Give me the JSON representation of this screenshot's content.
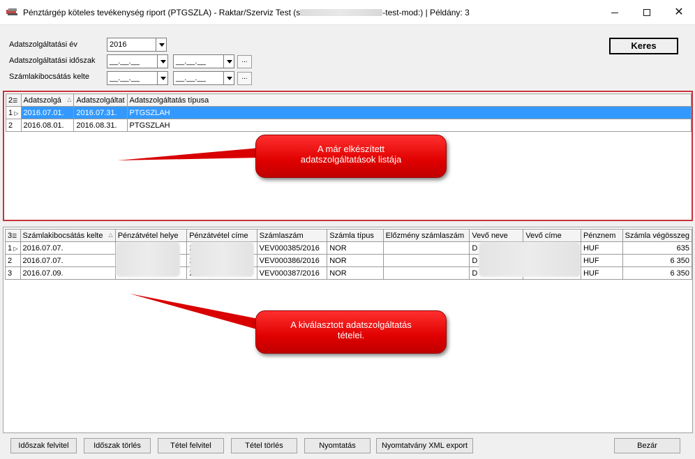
{
  "window": {
    "title_prefix": "Pénztárgép köteles tevékenység riport (PTGSZLA) - Raktar/Szerviz Test (s",
    "title_suffix": "-test-mod:) | Példány: 3",
    "minimize": "minimize",
    "maximize": "maximize",
    "close": "✕"
  },
  "filters": {
    "year_label": "Adatszolgáltatási év",
    "year_value": "2016",
    "period_label": "Adatszolgáltatási időszak",
    "period_from": "__.__.__",
    "period_to": "__.__.__",
    "invoice_date_label": "Számlakibocsátás kelte",
    "invoice_from": "__.__.__",
    "invoice_to": "__.__.__",
    "ellipsis": "...",
    "search_button": "Keres"
  },
  "grid1": {
    "corner": "2",
    "columns": [
      "Adatszolgá",
      "Adatszolgáltat",
      "Adatszolgáltatás típusa"
    ],
    "rows": [
      {
        "n": "1",
        "from": "2016.07.01.",
        "to": "2016.07.31.",
        "type": "PTGSZLAH"
      },
      {
        "n": "2",
        "from": "2016.08.01.",
        "to": "2016.08.31.",
        "type": "PTGSZLAH"
      }
    ]
  },
  "grid2": {
    "corner": "3",
    "columns": [
      "Számlakibocsátás kelte",
      "Pénzátvétel helye",
      "Pénzátvétel címe",
      "Számlaszám",
      "Számla típus",
      "Előzmény számlaszám",
      "Vevő neve",
      "Vevő címe",
      "Pénznem",
      "Számla végösszeg"
    ],
    "rows": [
      {
        "n": "1",
        "date": "2016.07.07.",
        "place": "",
        "addr": "2",
        "inv": "VEV000385/2016",
        "type": "NOR",
        "prev": "",
        "cust": "D",
        "caddr": "",
        "cur": "HUF",
        "total": "635"
      },
      {
        "n": "2",
        "date": "2016.07.07.",
        "place": "",
        "addr": "2",
        "inv": "VEV000386/2016",
        "type": "NOR",
        "prev": "",
        "cust": "D",
        "caddr": "",
        "cur": "HUF",
        "total": "6 350"
      },
      {
        "n": "3",
        "date": "2016.07.09.",
        "place": "",
        "addr": "2",
        "inv": "VEV000387/2016",
        "type": "NOR",
        "prev": "",
        "cust": "D",
        "caddr": "",
        "cur": "HUF",
        "total": "6 350"
      }
    ]
  },
  "callouts": {
    "c1_line1": "A már elkészített",
    "c1_line2": "adatszolgáltatások listája",
    "c2_line1": "A kiválasztott adatszolgáltatás",
    "c2_line2": "tételei."
  },
  "buttons": {
    "add_period": "Időszak felvitel",
    "delete_period": "Időszak törlés",
    "add_item": "Tétel felvitel",
    "delete_item": "Tétel törlés",
    "print": "Nyomtatás",
    "xml_export": "Nyomtatvány XML export",
    "close": "Bezár"
  },
  "colors": {
    "selection": "#3399ff",
    "callout": "#e00000",
    "panel_border": "#c8323a"
  }
}
